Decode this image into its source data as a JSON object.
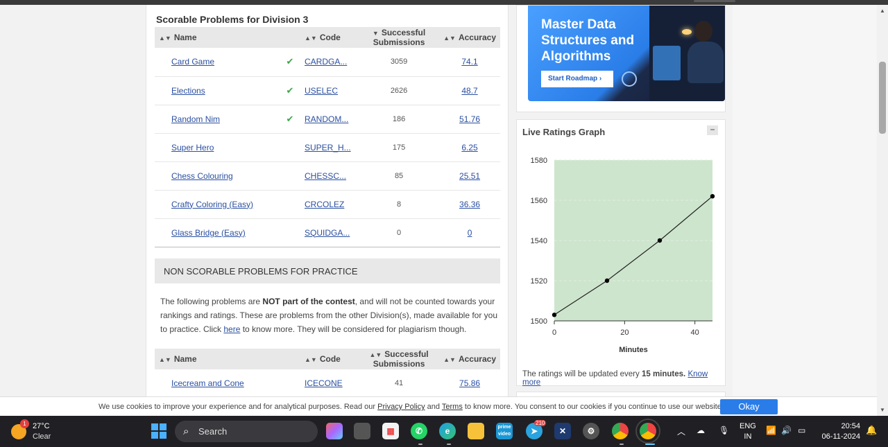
{
  "scorable": {
    "title": "Scorable Problems for Division 3",
    "columns": [
      "Name",
      "Code",
      "Successful Submissions",
      "Accuracy"
    ],
    "rows": [
      {
        "name": "Card Game",
        "solved": true,
        "code": "CARDGA...",
        "subs": "3059",
        "acc": "74.1"
      },
      {
        "name": "Elections",
        "solved": true,
        "code": "USELEC",
        "subs": "2626",
        "acc": "48.7"
      },
      {
        "name": "Random Nim",
        "solved": true,
        "code": "RANDOM...",
        "subs": "186",
        "acc": "51.76"
      },
      {
        "name": "Super Hero",
        "solved": false,
        "code": "SUPER_H...",
        "subs": "175",
        "acc": "6.25"
      },
      {
        "name": "Chess Colouring",
        "solved": false,
        "code": "CHESSC...",
        "subs": "85",
        "acc": "25.51"
      },
      {
        "name": "Crafty Coloring (Easy)",
        "solved": false,
        "code": "CRCOLEZ",
        "subs": "8",
        "acc": "36.36"
      },
      {
        "name": "Glass Bridge (Easy)",
        "solved": false,
        "code": "SQUIDGA...",
        "subs": "0",
        "acc": "0"
      }
    ]
  },
  "nonscorable": {
    "header": "NON SCORABLE PROBLEMS FOR PRACTICE",
    "text_a": "The following problems are ",
    "text_bold": "NOT part of the contest",
    "text_b": ", and will not be counted towards your rankings and ratings. These are problems from the other Division(s), made available for you to practice. Click ",
    "link": "here",
    "text_c": " to know more. They will be considered for plagiarism though.",
    "columns": [
      "Name",
      "Code",
      "Successful Submissions",
      "Accuracy"
    ],
    "rows": [
      {
        "name": "Icecream and Cone",
        "code": "ICECONE",
        "subs": "41",
        "acc": "75.86"
      }
    ]
  },
  "banner": {
    "title": "Master Data Structures and Algorithms",
    "button": "Start Roadmap",
    "button_icon": "chevron-right-icon"
  },
  "graph": {
    "title": "Live Ratings Graph",
    "collapse_label": "−",
    "note_a": "The ratings will be updated every ",
    "note_bold": "15 minutes.",
    "note_link": "Know more"
  },
  "chart_data": {
    "type": "line",
    "title": "",
    "xlabel": "Minutes",
    "ylabel": "",
    "x": [
      0,
      15,
      30,
      45
    ],
    "series": [
      {
        "values": [
          1503,
          1520,
          1540,
          1562
        ]
      }
    ],
    "xlim": [
      0,
      45
    ],
    "ylim": [
      1500,
      1580
    ],
    "xticks": [
      0,
      20,
      40
    ],
    "yticks": [
      1500,
      1520,
      1540,
      1560,
      1580
    ],
    "background": "#cde5cc",
    "line_color": "#222222",
    "grid": true
  },
  "cookie": {
    "text_a": "We use cookies to improve your experience and for analytical purposes. Read our ",
    "privacy": "Privacy Policy",
    "text_b": " and ",
    "terms": "Terms",
    "text_c": " to know more. You consent to our cookies if you continue to use our website.",
    "ok": "Okay"
  },
  "taskbar": {
    "weather_temp": "27°C",
    "weather_cond": "Clear",
    "weather_badge": "1",
    "search": "Search",
    "telegram_badge": "210",
    "lang_top": "ENG",
    "lang_bottom": "IN",
    "time": "20:54",
    "date": "06-11-2024"
  },
  "colors": {
    "link": "#2a4fa0",
    "check": "#3aa64a",
    "accent": "#2a7de8"
  }
}
